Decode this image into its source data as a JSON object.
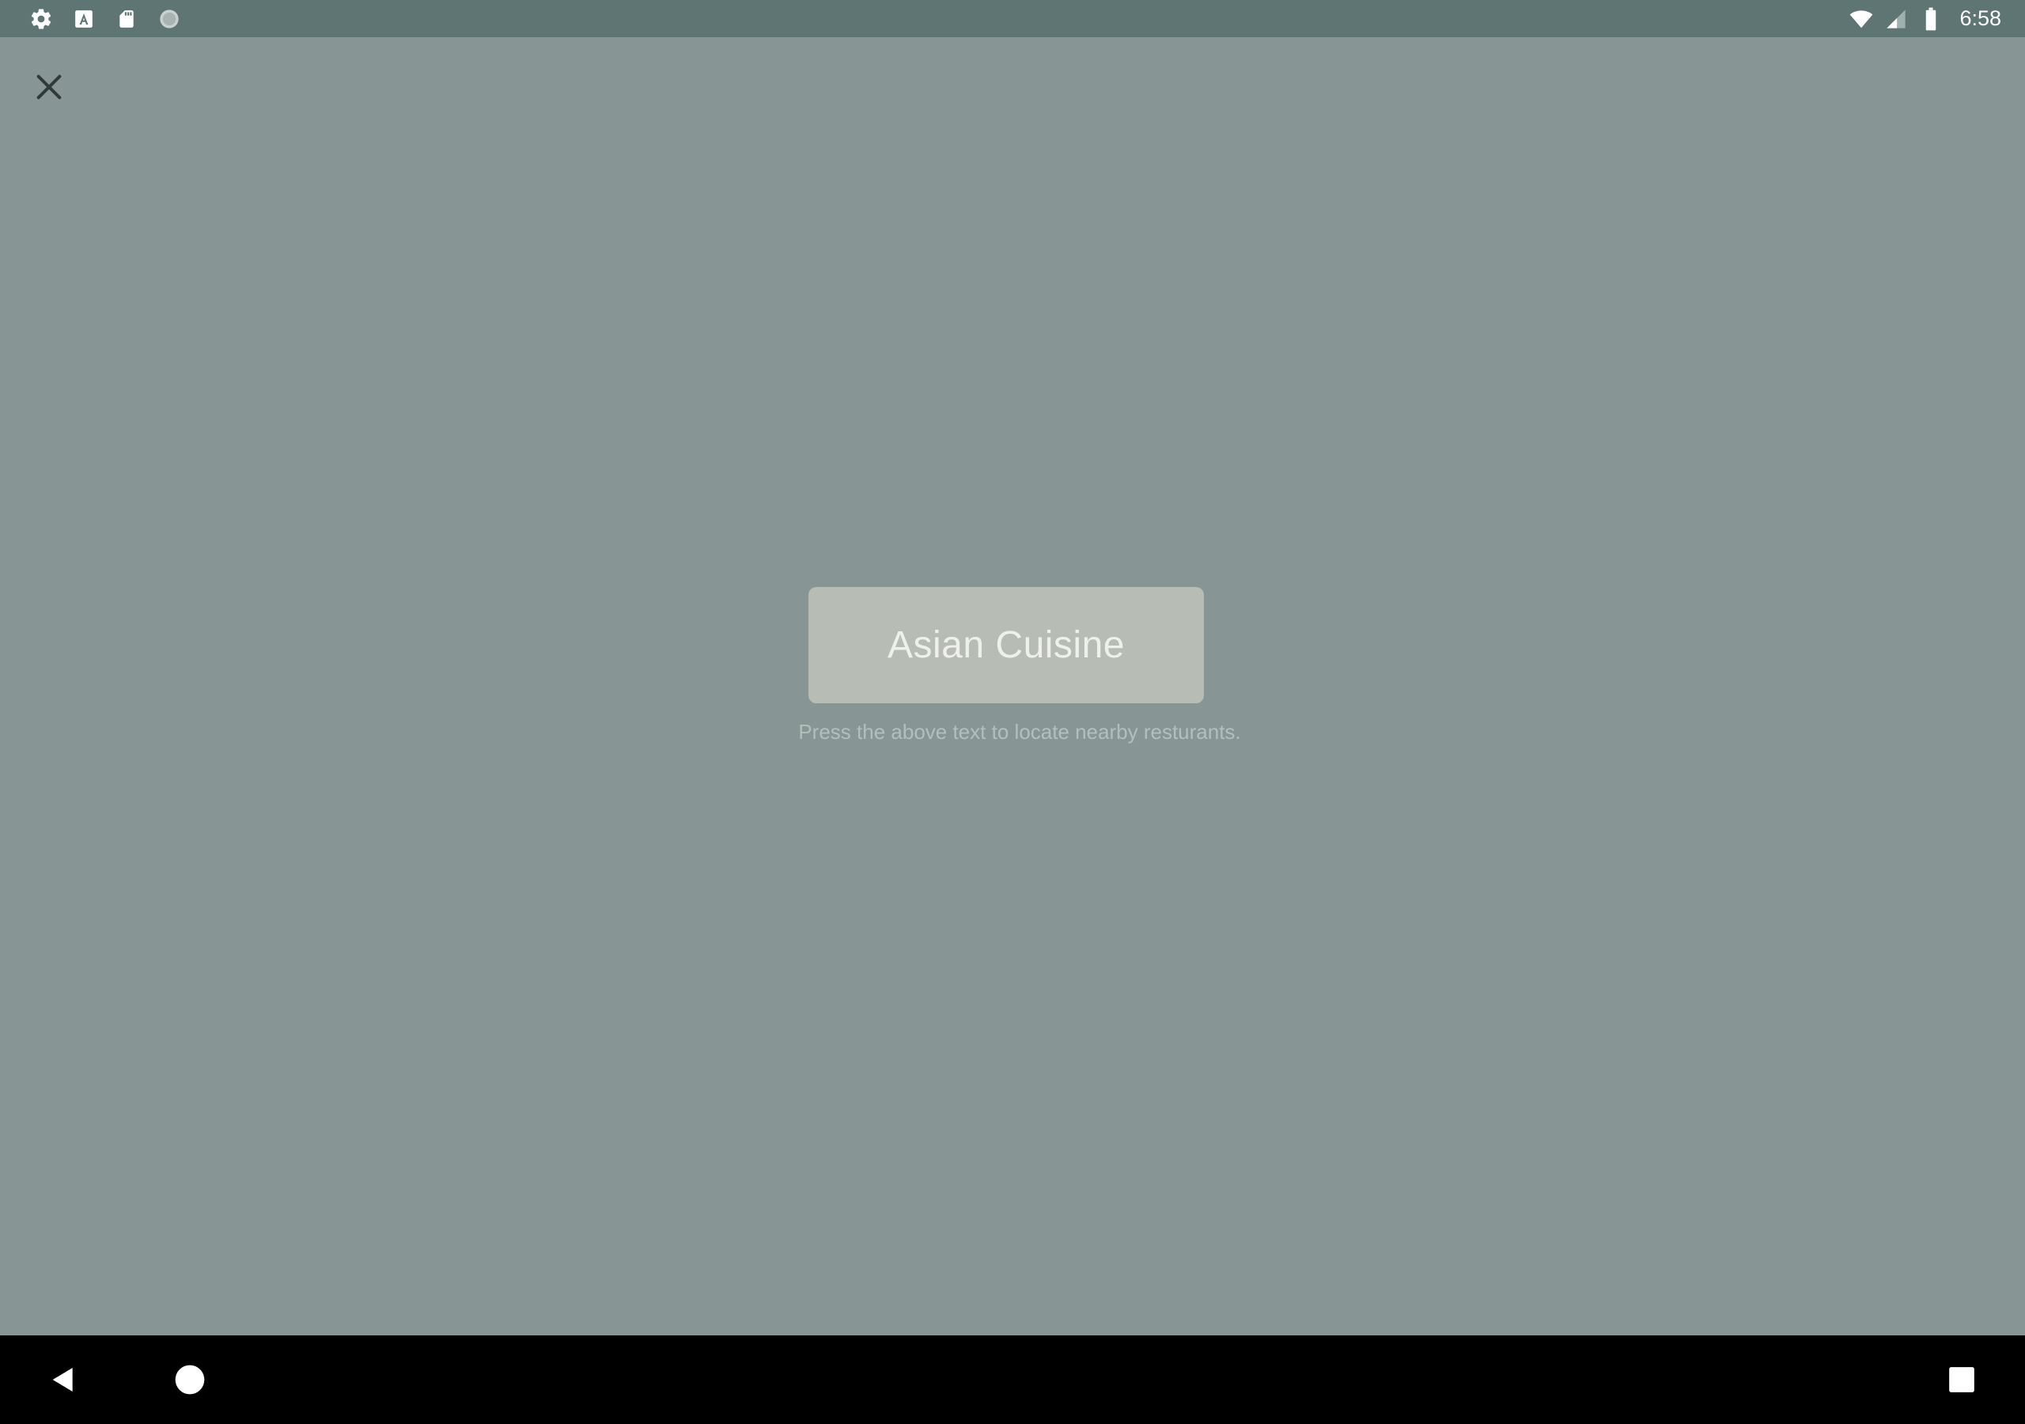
{
  "status_bar": {
    "left_icons": [
      "settings-icon",
      "text-a-icon",
      "sd-card-icon",
      "circle-icon"
    ],
    "right_icons": [
      "wifi-icon",
      "cell-signal-icon",
      "battery-icon"
    ],
    "time": "6:58",
    "background": "#5e7573"
  },
  "header": {
    "close_icon": "close-icon"
  },
  "main": {
    "cuisine_button_label": "Asian Cuisine",
    "hint": "Press the above text to locate nearby resturants.",
    "background": "#879695",
    "button_color": "#b7bcb5"
  },
  "nav_bar": {
    "buttons": [
      "back-icon",
      "home-icon",
      "recents-icon"
    ],
    "background": "#000000"
  }
}
